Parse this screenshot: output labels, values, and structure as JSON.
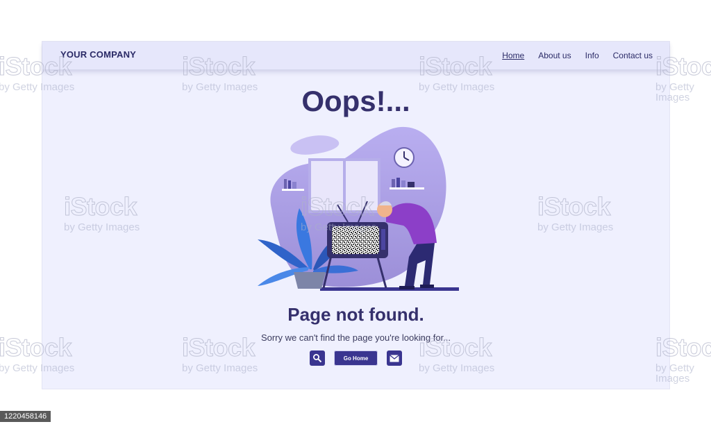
{
  "brand": "YOUR COMPANY",
  "nav": [
    "Home",
    "About us",
    "Info",
    "Contact us"
  ],
  "heading": "Oops!...",
  "title": "Page not found.",
  "subtitle": "Sorry we can't find the page you're looking for...",
  "actions": {
    "go_home": "Go Home"
  },
  "icons": {
    "search": "search-icon",
    "mail": "mail-icon"
  },
  "colors": {
    "accent": "#3a3590",
    "background": "#eff0fe",
    "text": "#35306c",
    "blob": "#a99de0"
  },
  "watermark": {
    "logo": "iStock",
    "credit": "by Getty Images"
  },
  "stock_id": "1220458146"
}
